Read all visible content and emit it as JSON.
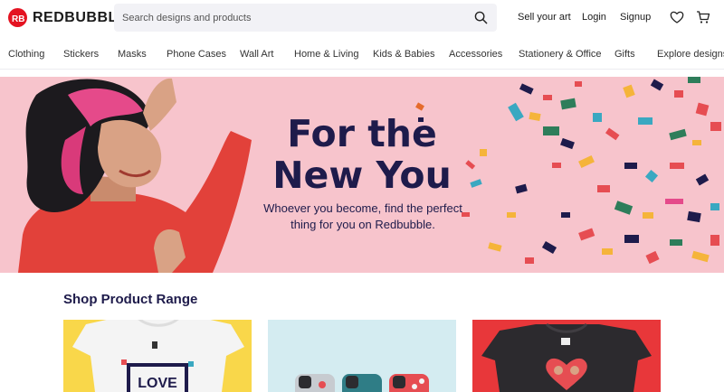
{
  "header": {
    "logo_text": "REDBUBBLE",
    "search_placeholder": "Search designs and products",
    "sell_label": "Sell your art",
    "login_label": "Login",
    "signup_label": "Signup"
  },
  "nav": {
    "items": [
      "Clothing",
      "Stickers",
      "Masks",
      "Phone Cases",
      "Wall Art",
      "Home & Living",
      "Kids & Babies",
      "Accessories",
      "Stationery & Office",
      "Gifts",
      "Explore designs"
    ]
  },
  "hero": {
    "title_line1": "For the",
    "title_line2": "New You",
    "subtitle_line1": "Whoever you become, find the perfect",
    "subtitle_line2": "thing for you on Redbubble."
  },
  "section": {
    "title": "Shop Product Range",
    "cards": [
      {
        "name": "tshirt-card",
        "bg": "#f9d74a",
        "art_text": "LOVE"
      },
      {
        "name": "phone-cases-card",
        "bg": "#d4ecf1"
      },
      {
        "name": "sweatshirt-card",
        "bg": "#e8373a"
      }
    ]
  },
  "colors": {
    "brand_red": "#e41321",
    "hero_bg": "#f7c4cc",
    "hero_text": "#1e1b4b"
  },
  "icons": [
    "logo-bubble-icon",
    "search-icon",
    "heart-icon",
    "cart-icon"
  ]
}
